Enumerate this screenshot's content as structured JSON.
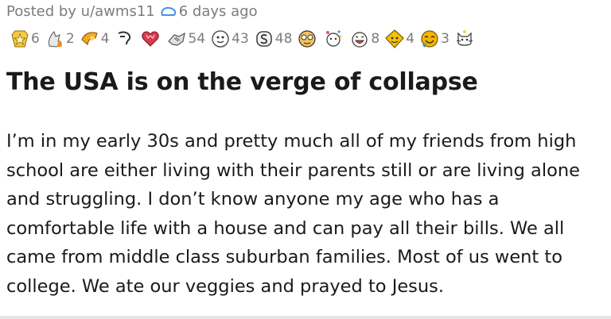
{
  "post": {
    "posted_by": "Posted by u/awms11",
    "time_ago": "6 days ago",
    "title": "The USA is on the verge of collapse",
    "body_lines": [
      "I’m in my early 30s and pretty much all of my friends from high",
      "school are either living with their parents still or are living alone",
      "and struggling. I don’t know anyone my age who has a",
      "comfortable life with a house and can pay all their bills. We all",
      "came from middle class suburban families. Most of us went to",
      "college. We ate our veggies and prayed to Jesus."
    ]
  },
  "awards": [
    {
      "icon": "gold-star-award-icon",
      "count": "6",
      "color": "#f6c945"
    },
    {
      "icon": "hand-flame-award-icon",
      "count": "2",
      "color": "#f08a24"
    },
    {
      "icon": "hand-heart-award-icon",
      "count": "4",
      "color": "#f6a623"
    },
    {
      "icon": "facepalm-award-icon",
      "count": "",
      "color": "#cccccc"
    },
    {
      "icon": "heart-award-icon",
      "count": "",
      "color": "#d93a4a"
    },
    {
      "icon": "handshake-award-icon",
      "count": "54",
      "color": "#9e9e9e"
    },
    {
      "icon": "face-award-icon",
      "count": "43",
      "color": "#aaaaaa"
    },
    {
      "icon": "coin-award-icon",
      "count": "48",
      "color": "#7a7a7a"
    },
    {
      "icon": "face-with-glasses-award-icon",
      "count": "",
      "color": "#f3c25a"
    },
    {
      "icon": "confetti-award-icon",
      "count": "",
      "color": "#d94ea0"
    },
    {
      "icon": "laughing-award-icon",
      "count": "8",
      "color": "#e3423b"
    },
    {
      "icon": "gold-face-award-icon",
      "count": "4",
      "color": "#f5c400"
    },
    {
      "icon": "wholesome-award-icon",
      "count": "3",
      "color": "#f5b400"
    },
    {
      "icon": "cat-award-icon",
      "count": "",
      "color": "#f4d03f"
    }
  ]
}
